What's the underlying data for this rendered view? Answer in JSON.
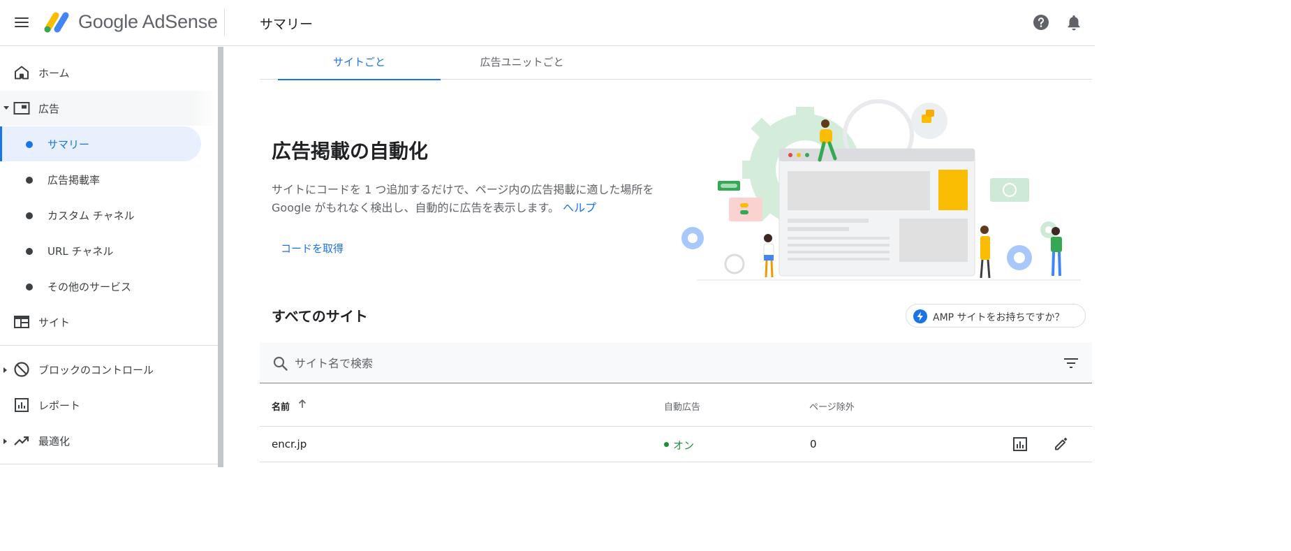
{
  "app": {
    "brand": "Google AdSense",
    "page_title": "サマリー"
  },
  "sidebar": {
    "items": [
      {
        "label": "ホーム",
        "icon": "home-icon"
      },
      {
        "label": "広告",
        "icon": "ads-icon",
        "expanded": true
      },
      {
        "label": "サマリー",
        "active": true
      },
      {
        "label": "広告掲載率"
      },
      {
        "label": "カスタム チャネル"
      },
      {
        "label": "URL チャネル"
      },
      {
        "label": "その他のサービス"
      },
      {
        "label": "サイト",
        "icon": "site-icon"
      },
      {
        "label": "ブロックのコントロール",
        "icon": "block-icon"
      },
      {
        "label": "レポート",
        "icon": "report-icon"
      },
      {
        "label": "最適化",
        "icon": "trending-icon"
      }
    ]
  },
  "tabs": [
    {
      "label": "サイトごと",
      "active": true
    },
    {
      "label": "広告ユニットごと"
    }
  ],
  "hero": {
    "title": "広告掲載の自動化",
    "description": "サイトにコードを 1 つ追加するだけで、ページ内の広告掲載に適した場所を Google がもれなく検出し、自動的に広告を表示します。",
    "help_link": "ヘルプ",
    "cta": "コードを取得"
  },
  "sites": {
    "title": "すべてのサイト",
    "amp_button": "AMP サイトをお持ちですか？",
    "search_placeholder": "サイト名で検索",
    "columns": {
      "name": "名前",
      "auto_ads": "自動広告",
      "page_exclusions": "ページ除外"
    },
    "rows": [
      {
        "name": "encr.jp",
        "auto_ads": "オン",
        "page_exclusions": "0"
      }
    ]
  },
  "colors": {
    "accent": "#1a73e8",
    "active_bg": "#e8f0fe",
    "status_on": "#1e8e3e"
  }
}
